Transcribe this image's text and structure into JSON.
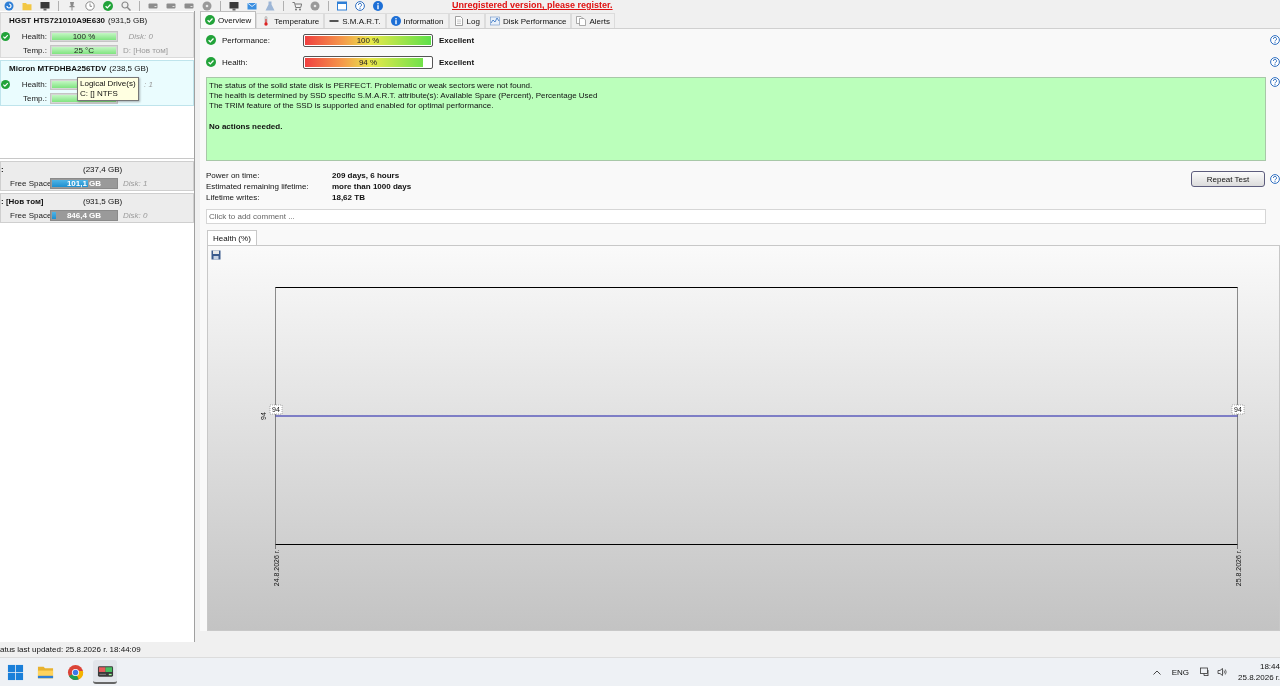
{
  "toolbar": {
    "notice": "Unregistered version, please register."
  },
  "disks": [
    {
      "name": "HGST HTS721010A9E630",
      "size": "(931,5 GB)",
      "selected": false,
      "health": {
        "label": "Health:",
        "level": 1,
        "value": "100 %"
      },
      "temp": {
        "label": "Temp.:",
        "level": 1,
        "value": "25 °C"
      },
      "disk_label": "Disk: 0",
      "drive_label": "D: [Нов том]"
    },
    {
      "name": "Micron MTFDHBA256TDV",
      "size": "(238,5 GB)",
      "selected": true,
      "health": {
        "label": "Health:",
        "level": 0.94
      },
      "temp": {
        "label": "Temp.:",
        "level": 1
      },
      "disk_label": ": 1"
    }
  ],
  "tooltip": {
    "lines": [
      "Logical Drive(s)",
      "C: [] NTFS"
    ]
  },
  "logical_drives": [
    {
      "name": ":",
      "size": "(237,4 GB)",
      "label": "Free Space",
      "level": 0.57,
      "value": "101,1 GB",
      "disk_label": "Disk: 1"
    },
    {
      "name": ": [Нов том]",
      "size": "(931,5 GB)",
      "label": "Free Space",
      "level": 0.07,
      "value": "846,4 GB",
      "disk_label": "Disk: 0"
    }
  ],
  "tabs": [
    {
      "label": "Overview",
      "kind": "check",
      "selected": true
    },
    {
      "label": "Temperature",
      "kind": "thermometer",
      "selected": false
    },
    {
      "label": "S.M.A.R.T.",
      "kind": "dash",
      "selected": false
    },
    {
      "label": "Information",
      "kind": "info",
      "selected": false
    },
    {
      "label": "Log",
      "kind": "document",
      "selected": false
    },
    {
      "label": "Disk Performance",
      "kind": "chart",
      "selected": false
    },
    {
      "label": "Alerts",
      "kind": "documents",
      "selected": false
    }
  ],
  "ratings": [
    {
      "label": "Performance:",
      "level": 1,
      "value": "100 %",
      "rating": "Excellent"
    },
    {
      "label": "Health:",
      "level": 0.94,
      "value": "94 %",
      "rating": "Excellent"
    }
  ],
  "status_message": {
    "lines": [
      "The status of the solid state disk is PERFECT. Problematic or weak sectors were not found.",
      "The health is determined by SSD specific S.M.A.R.T. attribute(s): Available Spare (Percent), Percentage Used",
      "The TRIM feature of the SSD is supported and enabled for optimal performance."
    ],
    "conclusion": "No actions needed."
  },
  "details": [
    {
      "label": "Power on time:",
      "value": "209 days, 6 hours"
    },
    {
      "label": "Estimated remaining lifetime:",
      "value": "more than 1000 days"
    },
    {
      "label": "Lifetime writes:",
      "value": "18,62 TB"
    }
  ],
  "repeat_button": "Repeat Test",
  "comment": {
    "placeholder": "Click to add comment ..."
  },
  "chart_tabs": [
    {
      "label": "Health (%)",
      "selected": true
    }
  ],
  "chart": {
    "axis_label": "94",
    "point_labels": [
      "94",
      "94"
    ],
    "x_labels": [
      "24.8.2026 г.",
      "25.8.2026 г."
    ]
  },
  "status_bar": {
    "text": "atus last updated: 25.8.2026 г. 18:44:09"
  },
  "taskbar": {
    "apps": [
      {
        "kind": "start",
        "selected": false
      },
      {
        "kind": "folder",
        "selected": false
      },
      {
        "kind": "browser",
        "selected": false
      },
      {
        "kind": "drive",
        "selected": true
      }
    ],
    "language": "ENG",
    "time": "18:44",
    "date": "25.8.2026 г."
  }
}
